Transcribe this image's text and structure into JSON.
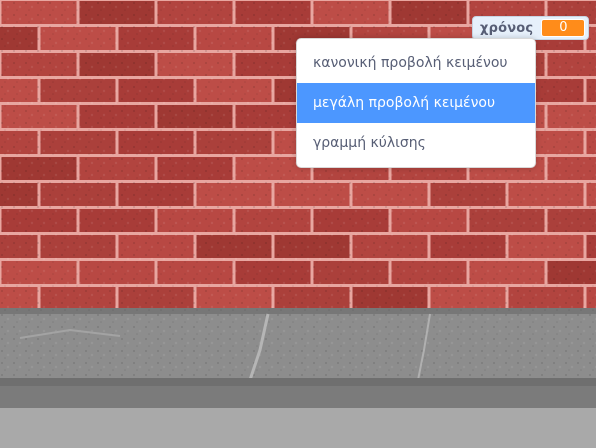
{
  "monitor": {
    "label": "χρόνος",
    "value": "0"
  },
  "context_menu": {
    "items": [
      {
        "label": "κανονική προβολή κειμένου"
      },
      {
        "label": "μεγάλη προβολή κειμένου",
        "highlighted": true
      },
      {
        "label": "γραμμή κύλισης"
      }
    ]
  },
  "colors": {
    "accent": "#4c97ff",
    "monitor_value_bg": "#ff8c1a",
    "brick": "#b2443f",
    "mortar": "#e8a6a0",
    "pavement": "#8a8a8a"
  }
}
